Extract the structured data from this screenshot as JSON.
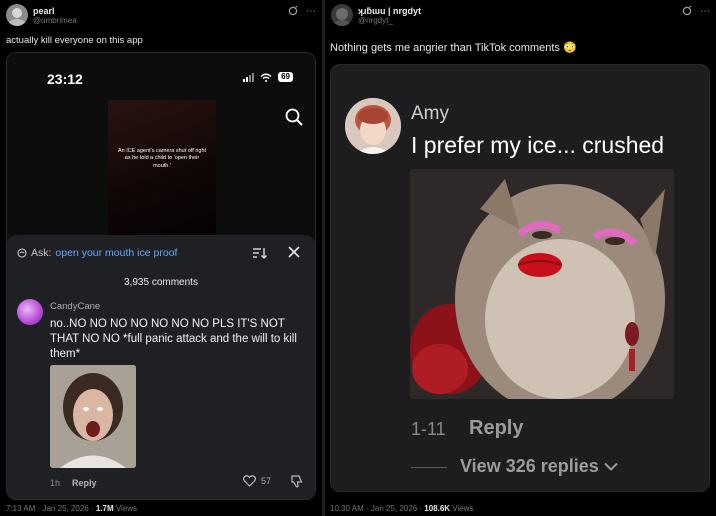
{
  "left_post": {
    "author_name": "pearl",
    "author_handle": "@umbrimea",
    "text": "actually kill everyone on this app",
    "footer_time": "7:13 AM · Jan 25, 2026 · ",
    "footer_views": "1.7M",
    "footer_views_label": " Views",
    "phone": {
      "time": "23:12",
      "battery": "69"
    },
    "video_caption": "An ICE agent's camera shut off right as he told a child to 'open their mouth.'",
    "ask_label": "Ask:",
    "ask_query": "open your mouth ice proof",
    "comment_count": "3,935 comments",
    "comment": {
      "username": "CandyCane",
      "body": "no..NO NO NO NO NO NO NO PLS IT'S NOT THAT NO NO *full panic attack and the will to kill them*",
      "age": "1h",
      "reply_label": "Reply",
      "likes": "57"
    }
  },
  "right_post": {
    "author_name": "ʞɹƃɯu | nrgdyt",
    "author_handle": "@nrgdyt_",
    "text": "Nothing gets me angrier than TikTok comments 😳",
    "footer_time": "10:30 AM · Jan 25, 2026 · ",
    "footer_views": "108.6K",
    "footer_views_label": " Views",
    "comment": {
      "username": "Amy",
      "body": "I prefer my ice... crushed",
      "date": "1-11",
      "reply_label": "Reply",
      "view_replies": "View 326 replies"
    }
  },
  "icons": {
    "header_actions": [
      "grok-icon",
      "more-icon"
    ],
    "left_media": [
      "signal-icon",
      "wifi-icon",
      "battery-icon",
      "search-icon",
      "sparkle-icon",
      "sort-icon",
      "close-icon",
      "heart-icon",
      "dislike-icon"
    ],
    "right_media": [
      "chevron-down-icon"
    ]
  },
  "colors": {
    "ask_query": "#5ea8ff",
    "panel_bg": "#1f2024",
    "card_bg": "#1d1d1f"
  }
}
